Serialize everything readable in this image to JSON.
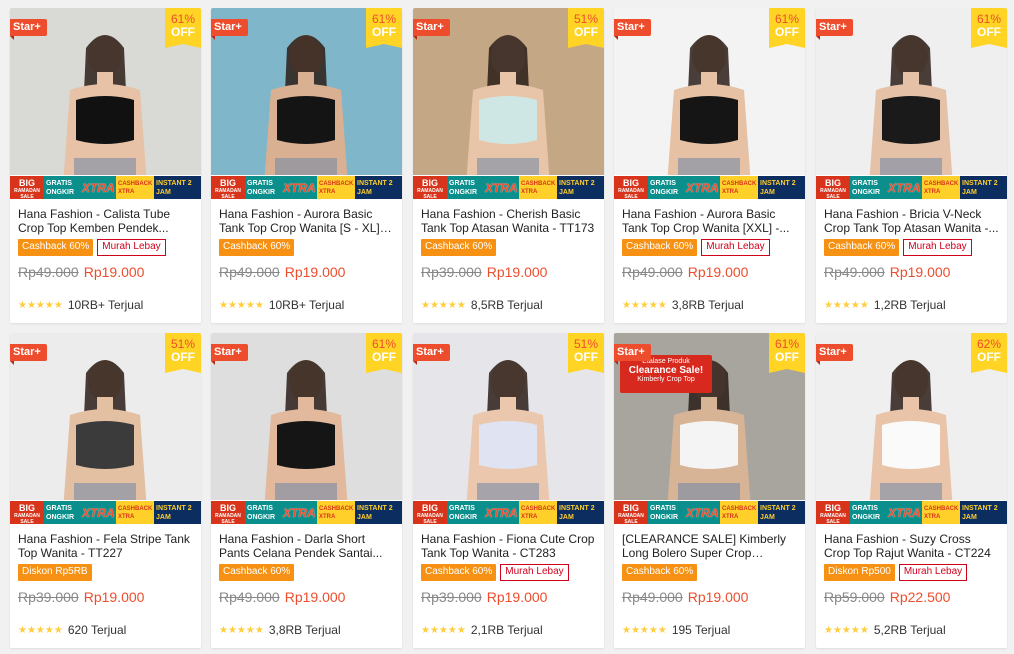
{
  "badges": {
    "star": "Star+",
    "off": "OFF"
  },
  "promo": {
    "big": "BIG",
    "big_sub": "RAMADAN SALE",
    "gratis": "GRATIS ONGKIR",
    "xtra": "XTRA",
    "cashback": "CASHBACK XTRA",
    "instant": "INSTANT 2 JAM"
  },
  "products": [
    {
      "title": "Hana Fashion - Calista Tube Crop Top Kemben Pendek...",
      "discount": "61%",
      "tags": [
        "Cashback 60%",
        "Murah Lebay"
      ],
      "old_price": "Rp49.000",
      "price": "Rp19.000",
      "stars": "★★★★★",
      "sold": "10RB+ Terjual",
      "photo_bg": "#d9d9d6",
      "outfit": "#111111",
      "skin": "#e7c2a6"
    },
    {
      "title": "Hana Fashion - Aurora Basic Tank Top Crop Wanita [S - XL] -...",
      "discount": "61%",
      "tags": [
        "Cashback 60%"
      ],
      "old_price": "Rp49.000",
      "price": "Rp19.000",
      "stars": "★★★★★",
      "sold": "10RB+ Terjual",
      "photo_bg": "#7fb6c9",
      "outfit": "#141414",
      "skin": "#d9b192"
    },
    {
      "title": "Hana Fashion - Cherish Basic Tank Top Atasan Wanita - TT173",
      "discount": "51%",
      "tags": [
        "Cashback 60%"
      ],
      "old_price": "Rp39.000",
      "price": "Rp19.000",
      "stars": "★★★★★",
      "sold": "8,5RB Terjual",
      "photo_bg": "#c4a785",
      "outfit": "#cfe7e4",
      "skin": "#e8c4a8"
    },
    {
      "title": "Hana Fashion - Aurora Basic Tank Top Crop Wanita [XXL] -...",
      "discount": "61%",
      "tags": [
        "Cashback 60%",
        "Murah Lebay"
      ],
      "old_price": "Rp49.000",
      "price": "Rp19.000",
      "stars": "★★★★★",
      "sold": "3,8RB Terjual",
      "photo_bg": "#f3f3f3",
      "outfit": "#151515",
      "skin": "#e6c1a4"
    },
    {
      "title": "Hana Fashion - Bricia V-Neck Crop Tank Top Atasan Wanita -...",
      "discount": "61%",
      "tags": [
        "Cashback 60%",
        "Murah Lebay"
      ],
      "old_price": "Rp49.000",
      "price": "Rp19.000",
      "stars": "★★★★★",
      "sold": "1,2RB Terjual",
      "photo_bg": "#efefef",
      "outfit": "#1a1a1a",
      "skin": "#e5c2a7"
    },
    {
      "title": "Hana Fashion - Fela Stripe Tank Top Wanita - TT227",
      "discount": "51%",
      "tags": [
        "Diskon Rp5RB"
      ],
      "old_price": "Rp39.000",
      "price": "Rp19.000",
      "stars": "★★★★★",
      "sold": "620 Terjual",
      "photo_bg": "#ececec",
      "outfit": "#3b3b3b",
      "skin": "#e4c0a3"
    },
    {
      "title": "Hana Fashion - Darla Short Pants Celana Pendek Santai...",
      "discount": "61%",
      "tags": [
        "Cashback 60%"
      ],
      "old_price": "Rp49.000",
      "price": "Rp19.000",
      "stars": "★★★★★",
      "sold": "3,8RB Terjual",
      "photo_bg": "#dedede",
      "outfit": "#151515",
      "skin": "#e2b99c"
    },
    {
      "title": "Hana Fashion - Fiona Cute Crop Tank Top Wanita - CT283",
      "discount": "51%",
      "tags": [
        "Cashback 60%",
        "Murah Lebay"
      ],
      "old_price": "Rp39.000",
      "price": "Rp19.000",
      "stars": "★★★★★",
      "sold": "2,1RB Terjual",
      "photo_bg": "#e6e6ea",
      "outfit": "#dfe3f2",
      "skin": "#ebc7ad"
    },
    {
      "title": "[CLEARANCE SALE] Kimberly Long Bolero Super Crop Murah...",
      "discount": "61%",
      "tags": [
        "Cashback 60%"
      ],
      "old_price": "Rp49.000",
      "price": "Rp19.000",
      "stars": "★★★★★",
      "sold": "195 Terjual",
      "photo_bg": "#a8a49e",
      "outfit": "#f4f4f4",
      "skin": "#d8b497",
      "clearance": {
        "line1": "Etalase Produk",
        "line2": "Clearance Sale!",
        "line3": "Kimberly Crop Top"
      }
    },
    {
      "title": "Hana Fashion - Suzy Cross Crop Top Rajut Wanita - CT224",
      "discount": "62%",
      "tags": [
        "Diskon Rp500",
        "Murah Lebay"
      ],
      "old_price": "Rp59.000",
      "price": "Rp22.500",
      "stars": "★★★★★",
      "sold": "5,2RB Terjual",
      "photo_bg": "#efefef",
      "outfit": "#fafafa",
      "skin": "#e9c4a8"
    }
  ]
}
